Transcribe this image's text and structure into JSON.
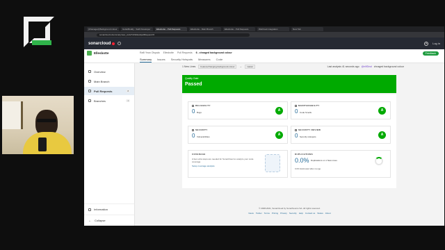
{
  "browser": {
    "tabs": [
      {
        "label": "[Chanaged] Background colour"
      },
      {
        "label": "GuitarBuddy - Swift Developer"
      },
      {
        "label": "Ellesbotte - Pull Requests"
      },
      {
        "label": "Ellesbotte - Main Branch"
      },
      {
        "label": "Ellesbotte - Pull Requests"
      },
      {
        "label": "Webhook integration"
      },
      {
        "label": "New Tab"
      }
    ],
    "url": "sonarcloud.io/summary/new_code?id=Elles&pullRequest=6"
  },
  "topnav": {
    "brand": "sonarcloud",
    "login": "Log in"
  },
  "project": {
    "name": "Ellesbotte",
    "breadcrumbs": [
      "Rafli Yean Olspala",
      "Ellesbotte",
      "Pull Requests"
    ],
    "current_pr": "6 - chnaged background colour",
    "tabs": [
      "Summary",
      "Issues",
      "Security Hotspots",
      "Measures",
      "Code"
    ],
    "feedback": "Feedback"
  },
  "sidebar": {
    "items": [
      {
        "label": "Overview",
        "badge": ""
      },
      {
        "label": "Main Branch",
        "badge": ""
      },
      {
        "label": "Pull Requests",
        "badge": "2"
      },
      {
        "label": "Branches",
        "badge": "1"
      }
    ],
    "information": "Information",
    "collapse": "Collapse"
  },
  "status": {
    "new_lines": "1 New Lines",
    "branch_from": "Feature/changing-background-colour",
    "branch_to": "master",
    "last_analysis": "Last analysis 41 seconds ago",
    "user": "@elifDeal",
    "commit": "chnaged background colour"
  },
  "quality_gate": {
    "label": "Quality Gate",
    "status": "Passed",
    "color": "#00aa00"
  },
  "metrics": {
    "reliability": {
      "title": "RELIABILITY",
      "value": "0",
      "label": "Bugs",
      "rating": "A"
    },
    "maintainability": {
      "title": "MAINTAINABILITY",
      "value": "0",
      "label": "Code Smells",
      "rating": "A"
    },
    "security": {
      "title": "SECURITY",
      "value": "0",
      "label": "Vulnerabilities",
      "rating": "A"
    },
    "security_review": {
      "title": "SECURITY REVIEW",
      "value": "0",
      "label": "Security Hotspots",
      "rating": "A"
    },
    "coverage": {
      "title": "COVERAGE",
      "text": "A few extra steps are needed for SonarCloud to analyze your code coverage",
      "link": "Setup coverage analysis"
    },
    "duplications": {
      "title": "DUPLICATIONS",
      "value": "0.0%",
      "label": "Duplications on 1 New Lines",
      "estimate": "0.0% Estimated after merge"
    }
  },
  "footer": {
    "copyright": "© 2008-2021, SonarCloud by SonarSource SA. All rights reserved.",
    "links": [
      "News",
      "Twitter",
      "Terms",
      "Pricing",
      "Privacy",
      "Security",
      "Help",
      "Contact us",
      "Status",
      "About"
    ]
  }
}
